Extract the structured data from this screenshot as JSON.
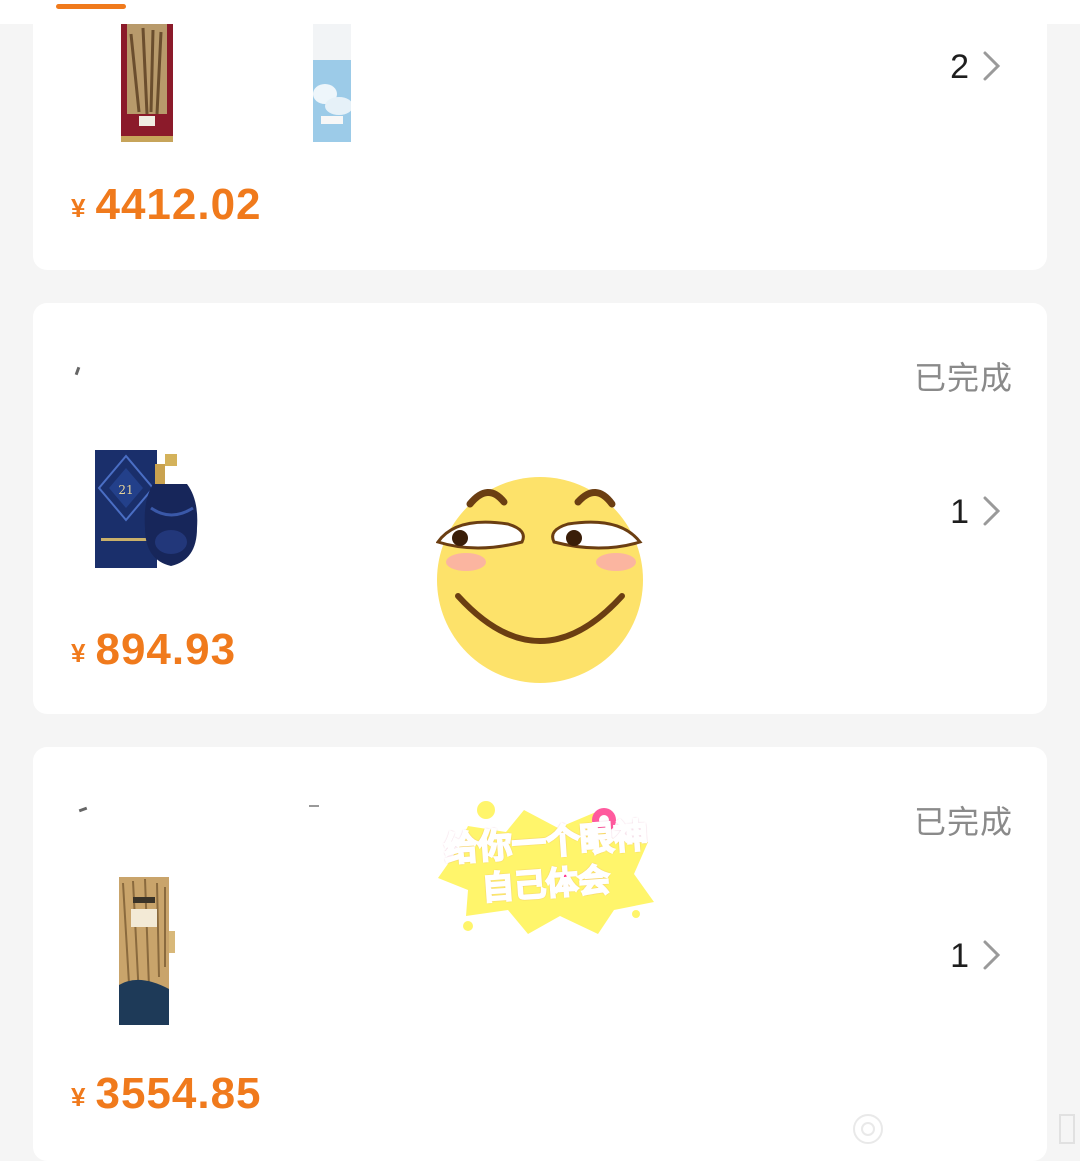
{
  "orders": [
    {
      "status": "",
      "quantity": "2",
      "currency": "¥",
      "price": "4412.02",
      "products": [
        "whisky-box-red",
        "whisky-box-sky"
      ]
    },
    {
      "status": "已完成",
      "quantity": "1",
      "currency": "¥",
      "price": "894.93",
      "products": [
        "royal-salute-21"
      ]
    },
    {
      "status": "已完成",
      "quantity": "1",
      "currency": "¥",
      "price": "3554.85",
      "products": [
        "macallan-box-gold"
      ]
    }
  ],
  "sticker": {
    "caption_line1": "给你一个眼神",
    "caption_line2": "自己体会"
  },
  "colors": {
    "accent": "#f07a1c",
    "status_gray": "#8a8a8a",
    "page_bg": "#f5f5f5"
  },
  "icons": [
    "chevron-right-icon",
    "smiling-emoji-sticker",
    "caption-sticker"
  ]
}
